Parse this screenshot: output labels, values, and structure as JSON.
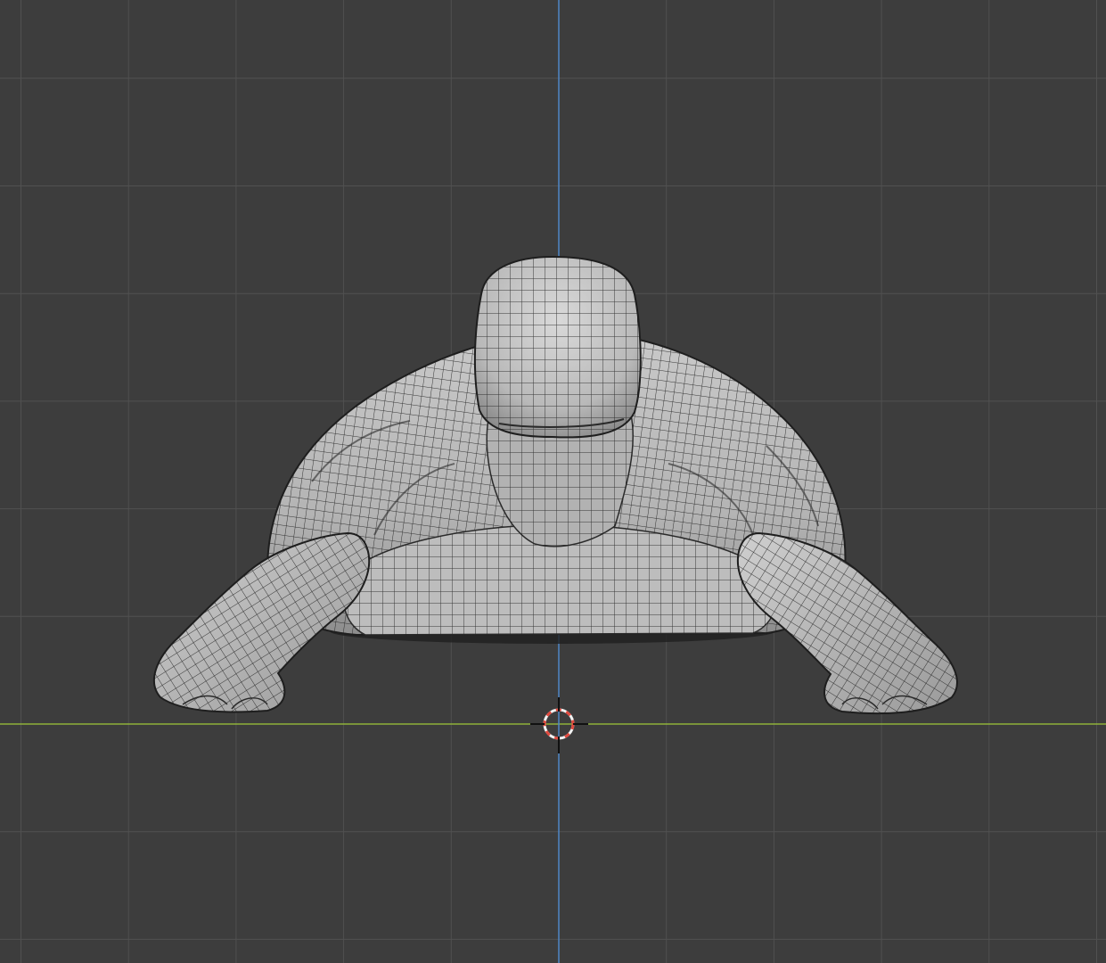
{
  "viewport": {
    "background_color": "#3d3d3d",
    "grid_minor_color": "#474747",
    "grid_major_color": "#515151",
    "x_axis_color": "#8fb23a",
    "z_axis_color": "#4f86c6",
    "mesh_fill_color": "#b8b8b8",
    "mesh_light_color": "#d6d6d6",
    "mesh_shadow_color": "#7e7e7e",
    "wireframe_color": "#1e1e1e",
    "cursor_color_a": "#e0493e",
    "cursor_color_b": "#f2f2f2"
  },
  "scene": {
    "object_icon": "turtle-mesh",
    "cursor_icon": "3d-cursor-icon"
  }
}
